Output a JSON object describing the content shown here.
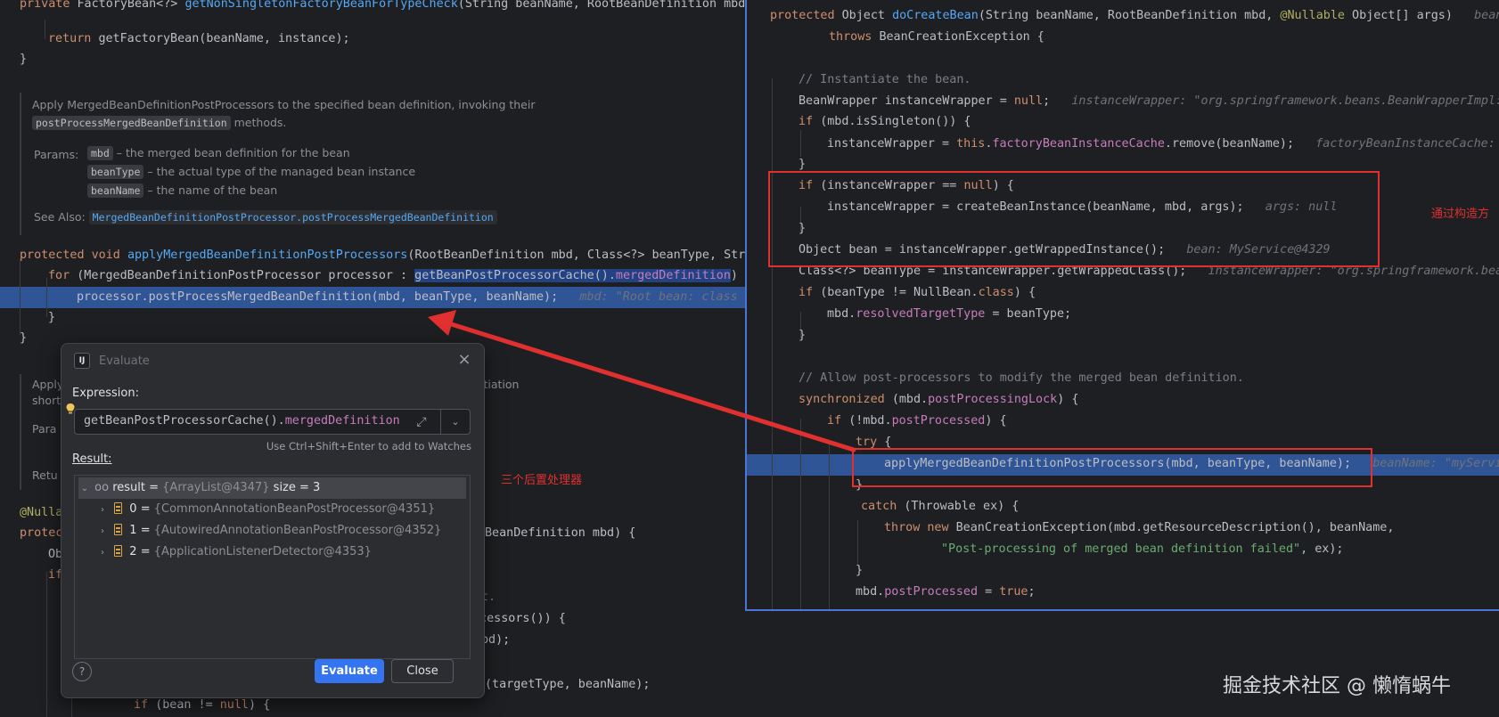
{
  "left_editor": {
    "lines": [
      {
        "id": "l0",
        "segments": [
          [
            "kw",
            "private "
          ],
          [
            "pl",
            "FactoryBean<?> "
          ],
          [
            "fn",
            "getNonSingletonFactoryBeanForTypeCheck"
          ],
          [
            "pl",
            "(String beanName, RootBeanDefinition mbd)"
          ]
        ]
      },
      {
        "id": "l1",
        "segments": [
          [
            "kw",
            "return "
          ],
          [
            "pl",
            "getFactoryBean(beanName, instance);"
          ]
        ]
      },
      {
        "id": "l2",
        "segments": [
          [
            "pl",
            "}"
          ]
        ]
      },
      {
        "id": "l3",
        "segments": [
          [
            "kw",
            "protected void "
          ],
          [
            "fn",
            "applyMergedBeanDefinitionPostProcessors"
          ],
          [
            "pl",
            "(RootBeanDefinition mbd, Class<?> beanType, Stri"
          ]
        ]
      },
      {
        "id": "l4",
        "segments": [
          [
            "kw",
            "for "
          ],
          [
            "pl",
            "(MergedBeanDefinitionPostProcessor processor : "
          ],
          [
            "sel",
            "getBeanPostProcessorCache()."
          ],
          [
            "selfield",
            "mergedDefinition"
          ],
          [
            "pl",
            ") {"
          ]
        ]
      },
      {
        "id": "l5",
        "segments": [
          [
            "pl",
            "processor.postProcessMergedBeanDefinition(mbd, beanType, beanName);   "
          ],
          [
            "hint",
            "mbd: \"Root bean: class [c"
          ]
        ]
      },
      {
        "id": "l6",
        "segments": [
          [
            "pl",
            "}"
          ]
        ]
      },
      {
        "id": "l7",
        "segments": [
          [
            "pl",
            "}"
          ]
        ]
      },
      {
        "id": "l8",
        "segments": [
          [
            "ann",
            "@Nulla"
          ]
        ]
      },
      {
        "id": "l9",
        "segments": [
          [
            "kw",
            "protec"
          ]
        ]
      },
      {
        "id": "l10",
        "segments": [
          [
            "pl",
            "Ob"
          ]
        ]
      },
      {
        "id": "l11",
        "segments": [
          [
            "kw",
            "if"
          ]
        ]
      },
      {
        "id": "l12",
        "segments": [
          [
            "pl",
            "BeanDefinition mbd) {"
          ]
        ]
      },
      {
        "id": "l13",
        "segments": [
          [
            "cm",
            "t."
          ]
        ]
      },
      {
        "id": "l14",
        "segments": [
          [
            "pl",
            "ocessors()) {"
          ]
        ]
      },
      {
        "id": "l15",
        "segments": [
          [
            "pl",
            "bd);"
          ]
        ]
      },
      {
        "id": "l16",
        "segments": [
          [
            "pl",
            "(targetType, beanName);"
          ]
        ]
      },
      {
        "id": "l17",
        "segments": [
          [
            "kw",
            "if "
          ],
          [
            "pl",
            "(bean != "
          ],
          [
            "kw",
            "null"
          ],
          [
            "pl",
            ") {"
          ]
        ]
      }
    ],
    "doc": {
      "summary_1": "Apply MergedBeanDefinitionPostProcessors to the specified bean definition, invoking their",
      "summary_code": "postProcessMergedBeanDefinition",
      "summary_2": "methods.",
      "params_label": "Params:",
      "params": [
        {
          "name": "mbd",
          "desc": "– the merged bean definition for the bean"
        },
        {
          "name": "beanType",
          "desc": "– the actual type of the managed bean instance"
        },
        {
          "name": "beanName",
          "desc": "– the name of the bean"
        }
      ],
      "see_also_label": "See Also:",
      "see_also_link": "MergedBeanDefinitionPostProcessor.postProcessMergedBeanDefinition"
    },
    "doc2": {
      "apply": "Apply",
      "short": "short",
      "para": "Para",
      "retu": "Retu",
      "tail": "tantiation"
    }
  },
  "right_editor": {
    "lines": [
      {
        "id": "r0",
        "segments": [
          [
            "kw",
            "protected "
          ],
          [
            "pl",
            "Object "
          ],
          [
            "fn",
            "doCreateBean"
          ],
          [
            "pl",
            "(String beanName, RootBeanDefinition mbd, "
          ],
          [
            "ann",
            "@Nullable "
          ],
          [
            "pl",
            "Object[] args)   "
          ],
          [
            "hint",
            "beanN"
          ]
        ]
      },
      {
        "id": "r1",
        "segments": [
          [
            "kw",
            "throws "
          ],
          [
            "pl",
            "BeanCreationException {"
          ]
        ]
      },
      {
        "id": "r2",
        "segments": [
          [
            "cm",
            "// Instantiate the bean."
          ]
        ]
      },
      {
        "id": "r3",
        "segments": [
          [
            "pl",
            "BeanWrapper instanceWrapper = "
          ],
          [
            "kw",
            "null"
          ],
          [
            "pl",
            ";   "
          ],
          [
            "hint",
            "instanceWrapper: \"org.springframework.beans.BeanWrapperImpl:"
          ]
        ]
      },
      {
        "id": "r4",
        "segments": [
          [
            "kw",
            "if "
          ],
          [
            "pl",
            "(mbd.isSingleton()) {"
          ]
        ]
      },
      {
        "id": "r5",
        "segments": [
          [
            "pl",
            "instanceWrapper = "
          ],
          [
            "kw",
            "this"
          ],
          [
            "pl",
            "."
          ],
          [
            "field",
            "factoryBeanInstanceCache"
          ],
          [
            "pl",
            ".remove(beanName);   "
          ],
          [
            "hint",
            "factoryBeanInstanceCache:"
          ]
        ]
      },
      {
        "id": "r6",
        "segments": [
          [
            "pl",
            "}"
          ]
        ]
      },
      {
        "id": "r7",
        "segments": [
          [
            "kw",
            "if "
          ],
          [
            "pl",
            "(instanceWrapper == "
          ],
          [
            "kw",
            "null"
          ],
          [
            "pl",
            ") {"
          ]
        ]
      },
      {
        "id": "r8",
        "segments": [
          [
            "pl",
            "instanceWrapper = createBeanInstance(beanName, mbd, args);   "
          ],
          [
            "hint",
            "args: null"
          ]
        ]
      },
      {
        "id": "r9",
        "segments": [
          [
            "pl",
            "}"
          ]
        ]
      },
      {
        "id": "r10",
        "segments": [
          [
            "pl",
            "Object bean = instanceWrapper.getWrappedInstance();   "
          ],
          [
            "hint",
            "bean: MyService@4329"
          ]
        ]
      },
      {
        "id": "r11",
        "segments": [
          [
            "pl",
            "Class<?> beanType = instanceWrapper.getWrappedClass();   "
          ],
          [
            "hint",
            "instanceWrapper: \"org.springframework.bea"
          ]
        ]
      },
      {
        "id": "r12",
        "segments": [
          [
            "kw",
            "if "
          ],
          [
            "pl",
            "(beanType != NullBean."
          ],
          [
            "kw",
            "class"
          ],
          [
            "pl",
            ") {"
          ]
        ]
      },
      {
        "id": "r13",
        "segments": [
          [
            "pl",
            "mbd."
          ],
          [
            "field",
            "resolvedTargetType"
          ],
          [
            "pl",
            " = beanType;"
          ]
        ]
      },
      {
        "id": "r14",
        "segments": [
          [
            "pl",
            "}"
          ]
        ]
      },
      {
        "id": "r15",
        "segments": [
          [
            "cm",
            "// Allow post-processors to modify the merged bean definition."
          ]
        ]
      },
      {
        "id": "r16",
        "segments": [
          [
            "kw",
            "synchronized "
          ],
          [
            "pl",
            "(mbd."
          ],
          [
            "field",
            "postProcessingLock"
          ],
          [
            "pl",
            ") {"
          ]
        ]
      },
      {
        "id": "r17",
        "segments": [
          [
            "kw",
            "if "
          ],
          [
            "pl",
            "(!mbd."
          ],
          [
            "field",
            "postProcessed"
          ],
          [
            "pl",
            ") {"
          ]
        ]
      },
      {
        "id": "r18",
        "segments": [
          [
            "kw",
            "try "
          ],
          [
            "pl",
            "{"
          ]
        ]
      },
      {
        "id": "r19",
        "segments": [
          [
            "pl",
            "applyMergedBeanDefinitionPostProcessors(mbd, beanType, beanName);   "
          ],
          [
            "hint",
            "beanName: \"myServic"
          ]
        ]
      },
      {
        "id": "r20",
        "segments": [
          [
            "pl",
            "}"
          ]
        ]
      },
      {
        "id": "r21",
        "segments": [
          [
            "kw",
            "catch "
          ],
          [
            "pl",
            "(Throwable ex) {"
          ]
        ]
      },
      {
        "id": "r22",
        "segments": [
          [
            "kw",
            "throw new "
          ],
          [
            "pl",
            "BeanCreationException(mbd.getResourceDescription(), beanName,"
          ]
        ]
      },
      {
        "id": "r23",
        "segments": [
          [
            "str",
            "\"Post-processing of merged bean definition failed\""
          ],
          [
            "pl",
            ", ex);"
          ]
        ]
      },
      {
        "id": "r24",
        "segments": [
          [
            "pl",
            "}"
          ]
        ]
      },
      {
        "id": "r25",
        "segments": [
          [
            "pl",
            "mbd."
          ],
          [
            "field",
            "postProcessed"
          ],
          [
            "pl",
            " = "
          ],
          [
            "kw",
            "true"
          ],
          [
            "pl",
            ";"
          ]
        ]
      }
    ]
  },
  "annotations": {
    "constructor_note": "通过构造方",
    "post_processors_note": "三个后置处理器"
  },
  "dialog": {
    "title": "Evaluate",
    "app_icon": "IJ",
    "expression_label": "Expression:",
    "expression_method": "getBeanPostProcessorCache().",
    "expression_field": "mergedDefinition",
    "watch_hint": "Use Ctrl+Shift+Enter to add to Watches",
    "result_label": "Result:",
    "result_root": {
      "name": "result",
      "eq": " = ",
      "type": "{ArrayList@4347}",
      "size": "size = 3"
    },
    "result_items": [
      {
        "index": "0",
        "eq": " = ",
        "value": "{CommonAnnotationBeanPostProcessor@4351}"
      },
      {
        "index": "1",
        "eq": " = ",
        "value": "{AutowiredAnnotationBeanPostProcessor@4352}"
      },
      {
        "index": "2",
        "eq": " = ",
        "value": "{ApplicationListenerDetector@4353}"
      }
    ],
    "evaluate_button": "Evaluate",
    "close_button": "Close",
    "help_button": "?"
  },
  "watermark": "掘金技术社区 @ 懒惰蜗牛",
  "colors": {
    "background": "#1e1f22",
    "keyword": "#cf8e6d",
    "function": "#56a8f5",
    "field": "#c77dbb",
    "string": "#6aab73",
    "comment": "#7a7e85",
    "annotation": "#b3ae60",
    "execution_line": "#2f5596",
    "red_box": "#e03030",
    "primary_button": "#3574f0"
  },
  "icons": [
    "ij-app-icon",
    "close-icon",
    "lightbulb-icon",
    "expand-icon",
    "history-dropdown-icon",
    "chevron-down-icon",
    "chevron-right-icon",
    "watch-glasses-icon",
    "list-icon",
    "help-icon",
    "arrow-icon"
  ]
}
